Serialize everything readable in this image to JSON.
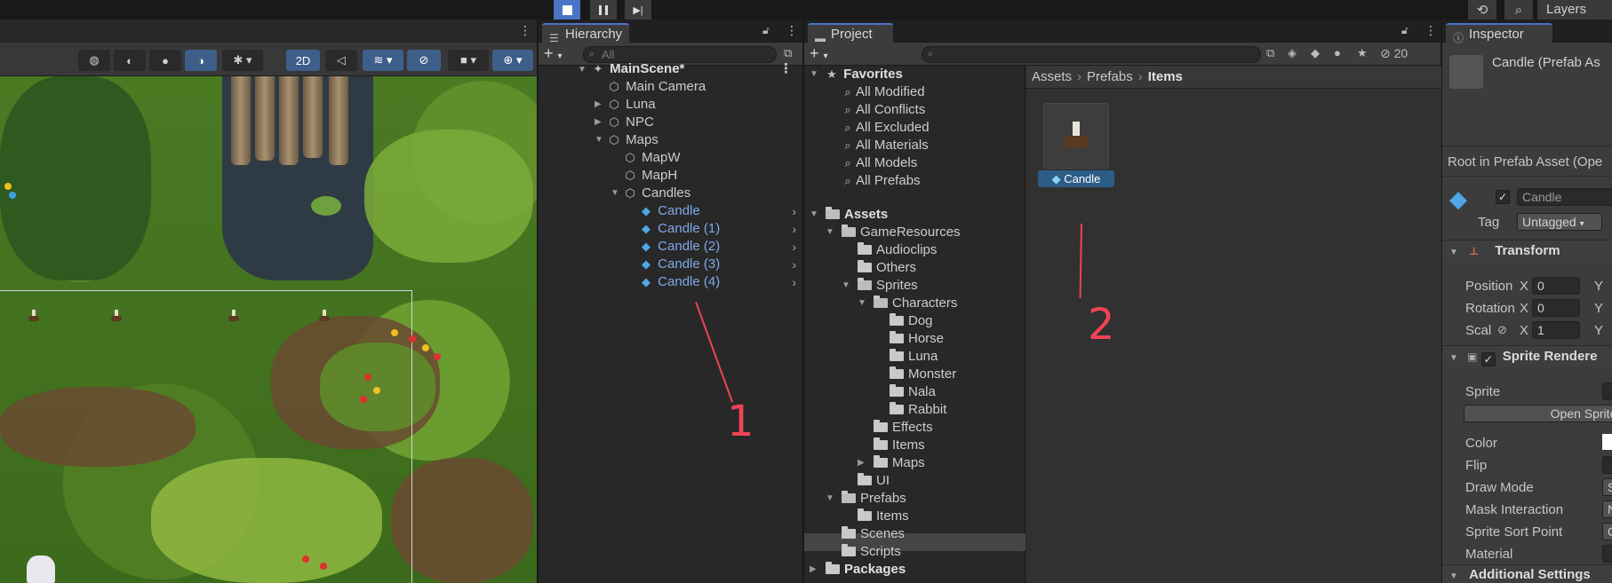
{
  "toolbar": {
    "play_icon": "stop-square-icon",
    "pause_icon": "pause-icon",
    "step_icon": "step-icon",
    "history_icon": "history-icon",
    "search_icon": "search-icon",
    "layers_label": "Layers"
  },
  "scene": {
    "mode_2d": "2D"
  },
  "hierarchy": {
    "tab_label": "Hierarchy",
    "search_placeholder": "All",
    "scene_name": "MainScene*",
    "items": [
      {
        "label": "Main Camera"
      },
      {
        "label": "Luna"
      },
      {
        "label": "NPC"
      },
      {
        "label": "Maps"
      },
      {
        "label": "MapW"
      },
      {
        "label": "MapH"
      },
      {
        "label": "Candles"
      },
      {
        "label": "Candle"
      },
      {
        "label": "Candle (1)"
      },
      {
        "label": "Candle (2)"
      },
      {
        "label": "Candle (3)"
      },
      {
        "label": "Candle (4)"
      }
    ]
  },
  "project": {
    "tab_label": "Project",
    "hidden_count": "20",
    "favorites": {
      "header": "Favorites",
      "items": [
        "All Modified",
        "All Conflicts",
        "All Excluded",
        "All Materials",
        "All Models",
        "All Prefabs"
      ]
    },
    "assets": {
      "header": "Assets",
      "tree": [
        {
          "label": "GameResources"
        },
        {
          "label": "Audioclips"
        },
        {
          "label": "Others"
        },
        {
          "label": "Sprites"
        },
        {
          "label": "Characters"
        },
        {
          "label": "Dog"
        },
        {
          "label": "Horse"
        },
        {
          "label": "Luna"
        },
        {
          "label": "Monster"
        },
        {
          "label": "Nala"
        },
        {
          "label": "Rabbit"
        },
        {
          "label": "Effects"
        },
        {
          "label": "Items"
        },
        {
          "label": "Maps"
        },
        {
          "label": "UI"
        },
        {
          "label": "Prefabs"
        },
        {
          "label": "Items"
        },
        {
          "label": "Scenes"
        },
        {
          "label": "Scripts"
        }
      ]
    },
    "packages_label": "Packages",
    "breadcrumb": [
      "Assets",
      "Prefabs",
      "Items"
    ],
    "asset_name": "Candle"
  },
  "inspector": {
    "tab_label": "Inspector",
    "title": "Candle (Prefab As",
    "root_prefab": "Root in Prefab Asset (Ope",
    "object_name": "Candle",
    "tag_label": "Tag",
    "tag_value": "Untagged",
    "transform": {
      "header": "Transform",
      "position_label": "Position",
      "rotation_label": "Rotation",
      "scale_label": "Scal",
      "x": "X",
      "y": "Y",
      "position_x": "0",
      "rotation_x": "0",
      "scale_x": "1"
    },
    "sprite_renderer": {
      "header": "Sprite Rendere",
      "sprite_label": "Sprite",
      "open_sprite_btn": "Open Sprite",
      "color_label": "Color",
      "flip_label": "Flip",
      "draw_mode_label": "Draw Mode",
      "draw_mode_value": "S",
      "mask_label": "Mask Interaction",
      "mask_value": "N",
      "sort_point_label": "Sprite Sort Point",
      "sort_point_value": "C",
      "material_label": "Material"
    },
    "additional_settings": "Additional Settings"
  },
  "annotations": {
    "one": "1",
    "two": "2",
    "color": "#ee4455"
  }
}
